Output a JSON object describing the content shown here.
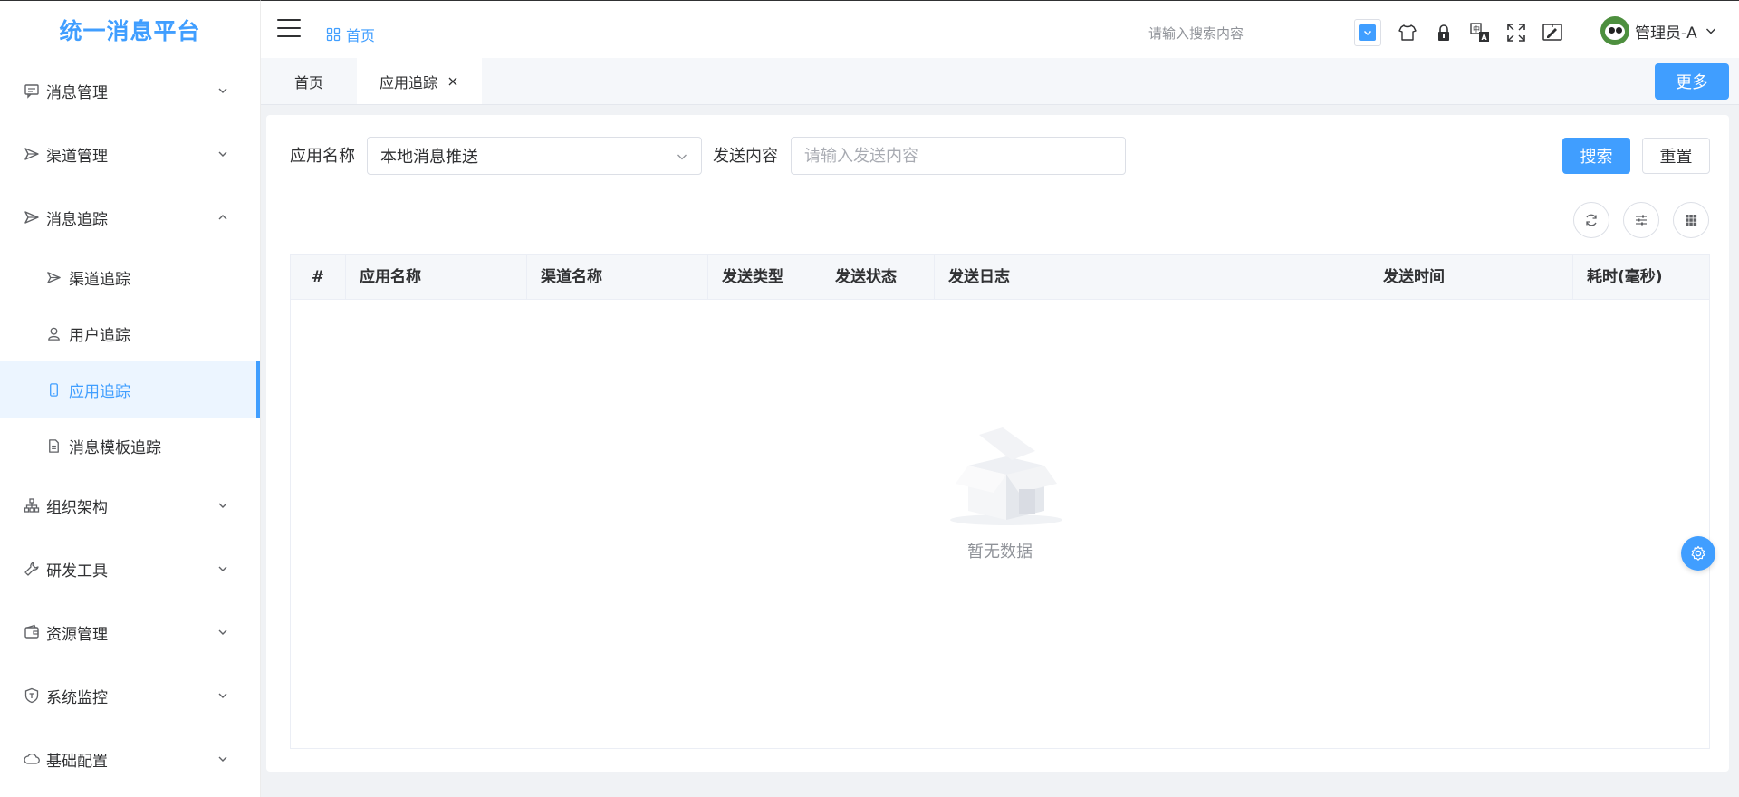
{
  "app": {
    "title": "统一消息平台"
  },
  "sidebar": {
    "items": [
      {
        "label": "消息管理",
        "icon": "message-icon"
      },
      {
        "label": "渠道管理",
        "icon": "send-icon"
      },
      {
        "label": "消息追踪",
        "icon": "send-icon",
        "expanded": true,
        "children": [
          {
            "label": "渠道追踪",
            "icon": "send-icon"
          },
          {
            "label": "用户追踪",
            "icon": "user-icon"
          },
          {
            "label": "应用追踪",
            "icon": "phone-icon",
            "active": true
          },
          {
            "label": "消息模板追踪",
            "icon": "document-icon"
          }
        ]
      },
      {
        "label": "组织架构",
        "icon": "org-chart-icon"
      },
      {
        "label": "研发工具",
        "icon": "wrench-icon"
      },
      {
        "label": "资源管理",
        "icon": "wallet-icon"
      },
      {
        "label": "系统监控",
        "icon": "shield-icon"
      },
      {
        "label": "基础配置",
        "icon": "cloud-icon"
      }
    ]
  },
  "header": {
    "breadcrumb": "首页",
    "search_placeholder": "请输入搜索内容",
    "username": "管理员-A"
  },
  "tabs": {
    "home": "首页",
    "active": "应用追踪",
    "more": "更多"
  },
  "filter": {
    "app_name_label": "应用名称",
    "app_name_value": "本地消息推送",
    "content_label": "发送内容",
    "content_placeholder": "请输入发送内容",
    "search_button": "搜索",
    "reset_button": "重置"
  },
  "table": {
    "columns": [
      "#",
      "应用名称",
      "渠道名称",
      "发送类型",
      "发送状态",
      "发送日志",
      "发送时间",
      "耗时(毫秒)"
    ],
    "rows": [],
    "empty_text": "暂无数据"
  },
  "colors": {
    "primary": "#409eff",
    "active_bg": "#ecf5ff"
  }
}
